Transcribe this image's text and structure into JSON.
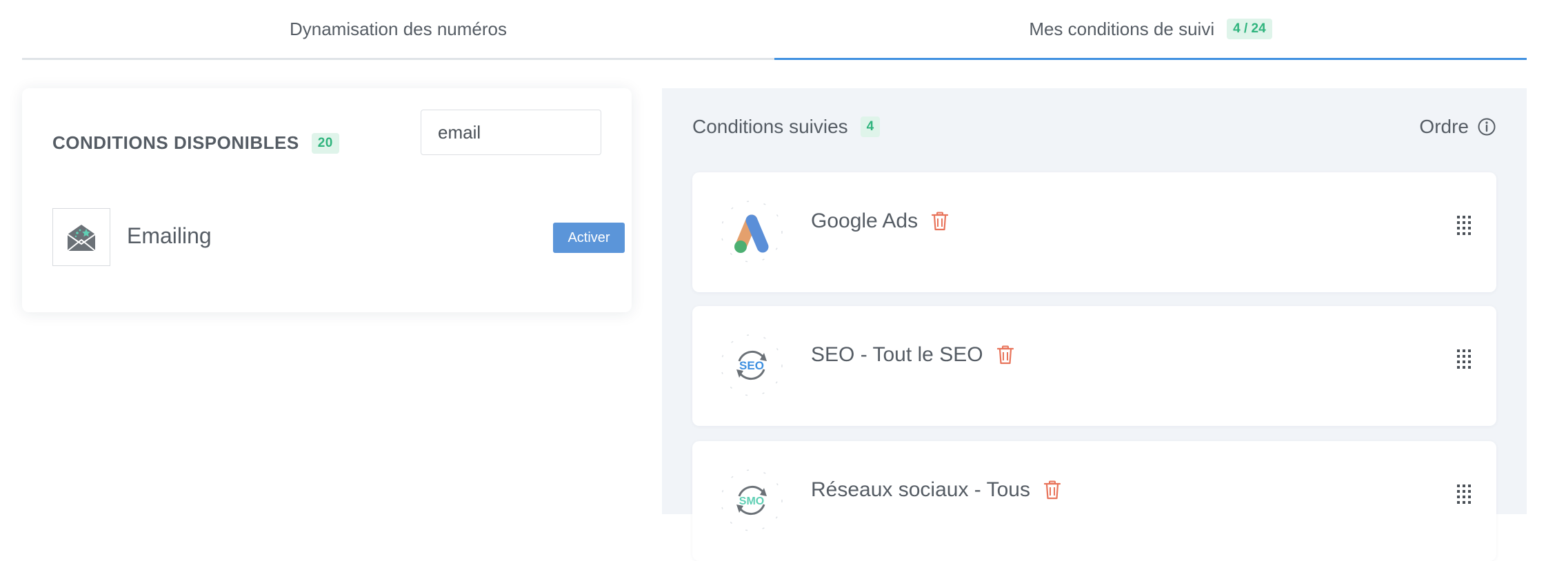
{
  "tabs": [
    {
      "label": "Dynamisation des numéros"
    },
    {
      "label": "Mes conditions de suivi",
      "badge": "4 / 24"
    }
  ],
  "available": {
    "title": "CONDITIONS DISPONIBLES",
    "count": "20",
    "search_value": "email",
    "items": [
      {
        "name": "Emailing",
        "button": "Activer",
        "icon": "envelope-icon"
      }
    ]
  },
  "tracked": {
    "title": "Conditions suivies",
    "count": "4",
    "order_label": "Ordre",
    "items": [
      {
        "name": "Google Ads",
        "icon": "google-ads-icon"
      },
      {
        "name": "SEO - Tout le SEO",
        "icon": "seo-icon",
        "logo_text": "SEO"
      },
      {
        "name": "Réseaux sociaux - Tous",
        "icon": "smo-icon",
        "logo_text": "SMO"
      }
    ]
  },
  "colors": {
    "accent": "#3d8fe0",
    "badge_bg": "#dff4ea",
    "badge_text": "#2fb47d",
    "button": "#5b95d9",
    "trash": "#e8735a"
  }
}
